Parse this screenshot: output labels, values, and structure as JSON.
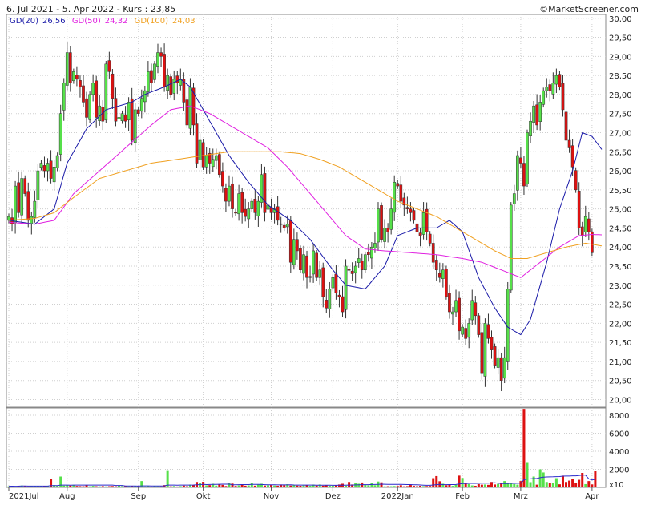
{
  "header": {
    "range_text": "6. Jul 2021 - 5. Apr 2022 - Kurs : 23,85",
    "source_text": "©MarketScreener.com"
  },
  "legend": {
    "gd20_label": "GD(20)",
    "gd20_value": "26,56",
    "gd50_label": "GD(50)",
    "gd50_value": "24,32",
    "gd100_label": "GD(100)",
    "gd100_value": "24,03"
  },
  "colors": {
    "up": "#56e04a",
    "down": "#dd1111",
    "wick": "#333333",
    "gd20": "#1a1aa8",
    "gd50": "#e020e0",
    "gd100": "#f0a020",
    "grid": "#cfcfcf",
    "vol_avg": "#2a2acc"
  },
  "chart_data": [
    {
      "type": "candlestick",
      "title": "6. Jul 2021 - 5. Apr 2022 - Kurs : 23,85",
      "last_price": 23.85,
      "ylim": [
        19.8,
        30.1
      ],
      "y_ticks": [
        "30,00",
        "29,50",
        "29,00",
        "28,50",
        "28,00",
        "27,50",
        "27,00",
        "26,50",
        "26,00",
        "25,50",
        "25,00",
        "24,50",
        "24,00",
        "23,50",
        "23,00",
        "22,50",
        "22,00",
        "21,50",
        "21,00",
        "20,50",
        "20,00"
      ],
      "y_tick_values": [
        30,
        29.5,
        29,
        28.5,
        28,
        27.5,
        27,
        26.5,
        26,
        25.5,
        25,
        24.5,
        24,
        23.5,
        23,
        22.5,
        22,
        21.5,
        21,
        20.5,
        20
      ],
      "x_ticks": [
        "2021Jul",
        "Aug",
        "Sep",
        "Okt",
        "Nov",
        "Dez",
        "2022Jan",
        "Feb",
        "Mrz",
        "Apr"
      ],
      "x_tick_index": [
        0,
        18,
        40,
        60,
        81,
        100,
        120,
        140,
        158,
        180
      ],
      "grid": true,
      "n_sessions": 184,
      "close": [
        24.8,
        24.6,
        25.6,
        24.9,
        25.8,
        25.4,
        24.7,
        24.8,
        25.2,
        26.0,
        26.2,
        26.0,
        26.2,
        25.8,
        26.1,
        26.4,
        27.5,
        28.3,
        29.1,
        28.3,
        28.6,
        28.4,
        28.2,
        27.8,
        27.4,
        28.0,
        28.3,
        27.4,
        27.7,
        27.3,
        28.8,
        28.6,
        27.9,
        27.3,
        27.4,
        27.5,
        27.3,
        27.8,
        26.8,
        27.6,
        27.5,
        27.9,
        28.1,
        28.6,
        28.3,
        28.8,
        29.1,
        29.0,
        28.2,
        28.5,
        28.0,
        28.4,
        28.3,
        28.4,
        27.8,
        27.2,
        28.2,
        27.2,
        26.2,
        26.8,
        26.1,
        26.4,
        26.2,
        26.3,
        26.4,
        25.9,
        25.6,
        25.2,
        25.6,
        25.0,
        24.9,
        25.4,
        24.9,
        24.8,
        25.0,
        25.2,
        24.9,
        25.2,
        25.9,
        24.9,
        25.1,
        24.9,
        25.0,
        24.7,
        24.6,
        24.5,
        24.6,
        23.6,
        24.2,
        23.9,
        23.4,
        23.8,
        23.2,
        23.2,
        23.9,
        23.2,
        23.4,
        22.7,
        22.4,
        22.9,
        23.2,
        22.8,
        22.7,
        22.3,
        23.5,
        23.4,
        23.3,
        23.5,
        23.7,
        23.4,
        23.8,
        23.8,
        24.0,
        24.1,
        25.0,
        24.2,
        24.5,
        24.4,
        25.0,
        25.7,
        25.6,
        25.2,
        25.1,
        25.0,
        24.9,
        24.7,
        24.4,
        24.3,
        24.9,
        24.4,
        24.1,
        23.6,
        23.4,
        23.2,
        23.4,
        22.7,
        22.3,
        22.3,
        22.6,
        21.8,
        21.9,
        21.6,
        22.0,
        22.6,
        22.2,
        21.7,
        20.7,
        22.0,
        21.6,
        21.3,
        20.9,
        21.1,
        20.5,
        21.1,
        22.9,
        25.1,
        25.4,
        26.4,
        26.2,
        25.6,
        27.0,
        27.3,
        27.7,
        27.2,
        27.8,
        28.1,
        28.2,
        28.1,
        28.3,
        28.5,
        28.2,
        27.6,
        26.8,
        26.6,
        26.1,
        25.5,
        24.5,
        24.3,
        24.8,
        24.4,
        23.85
      ],
      "volume": [
        120,
        150,
        100,
        180,
        200,
        160,
        110,
        130,
        140,
        160,
        150,
        130,
        170,
        900,
        250,
        180,
        1200,
        200,
        230,
        200,
        220,
        160,
        140,
        130,
        220,
        120,
        170,
        130,
        120,
        140,
        110,
        130,
        150,
        120,
        200,
        140,
        130,
        120,
        150,
        140,
        120,
        700,
        110,
        130,
        100,
        150,
        120,
        110,
        250,
        1900,
        120,
        150,
        100,
        140,
        200,
        130,
        300,
        260,
        600,
        500,
        620,
        220,
        250,
        400,
        200,
        340,
        280,
        150,
        500,
        420,
        160,
        220,
        300,
        190,
        220,
        500,
        190,
        300,
        400,
        200,
        230,
        300,
        200,
        180,
        320,
        240,
        350,
        200,
        260,
        200,
        180,
        210,
        260,
        180,
        310,
        200,
        320,
        190,
        220,
        190,
        180,
        260,
        320,
        400,
        190,
        600,
        320,
        520,
        400,
        540,
        260,
        230,
        500,
        240,
        650,
        560,
        120,
        130,
        130,
        150,
        160,
        240,
        120,
        140,
        260,
        170,
        130,
        180,
        140,
        150,
        160,
        1020,
        1250,
        680,
        400,
        240,
        300,
        170,
        280,
        1300,
        1040,
        450,
        360,
        220,
        180,
        360,
        300,
        320,
        280,
        600,
        320,
        380,
        400,
        700,
        420,
        500,
        360,
        300,
        700,
        8700,
        2800,
        580,
        1200,
        300,
        2000,
        1650,
        600,
        480,
        500,
        1020,
        340,
        1300,
        600,
        750,
        920,
        480,
        840,
        1600,
        360,
        700,
        330,
        1800
      ],
      "vol_ylim": [
        0,
        8800
      ],
      "vol_ticks": [
        "8000",
        "6000",
        "4000",
        "2000"
      ],
      "vol_tick_values": [
        8000,
        6000,
        4000,
        2000
      ],
      "vol_unit_label": "x10",
      "series": [
        {
          "name": "GD(20)",
          "last": 26.56,
          "anchors": [
            [
              0,
              24.7
            ],
            [
              8,
              24.6
            ],
            [
              14,
              25.0
            ],
            [
              18,
              26.2
            ],
            [
              24,
              27.1
            ],
            [
              30,
              27.6
            ],
            [
              38,
              27.8
            ],
            [
              42,
              28.0
            ],
            [
              48,
              28.2
            ],
            [
              53,
              28.4
            ],
            [
              56,
              28.2
            ],
            [
              62,
              27.3
            ],
            [
              68,
              26.4
            ],
            [
              74,
              25.7
            ],
            [
              80,
              25.1
            ],
            [
              87,
              24.7
            ],
            [
              93,
              24.2
            ],
            [
              100,
              23.4
            ],
            [
              104,
              23.0
            ],
            [
              110,
              22.9
            ],
            [
              116,
              23.5
            ],
            [
              120,
              24.3
            ],
            [
              126,
              24.5
            ],
            [
              132,
              24.5
            ],
            [
              136,
              24.7
            ],
            [
              140,
              24.4
            ],
            [
              145,
              23.2
            ],
            [
              150,
              22.4
            ],
            [
              154,
              21.9
            ],
            [
              158,
              21.7
            ],
            [
              161,
              22.1
            ],
            [
              166,
              23.6
            ],
            [
              170,
              25.0
            ],
            [
              174,
              26.0
            ],
            [
              177,
              27.0
            ],
            [
              180,
              26.9
            ],
            [
              183,
              26.56
            ]
          ]
        },
        {
          "name": "GD(50)",
          "last": 24.32,
          "anchors": [
            [
              0,
              24.65
            ],
            [
              8,
              24.6
            ],
            [
              14,
              24.7
            ],
            [
              20,
              25.4
            ],
            [
              28,
              26.0
            ],
            [
              36,
              26.6
            ],
            [
              44,
              27.2
            ],
            [
              50,
              27.6
            ],
            [
              56,
              27.7
            ],
            [
              62,
              27.5
            ],
            [
              68,
              27.2
            ],
            [
              74,
              26.9
            ],
            [
              80,
              26.6
            ],
            [
              86,
              26.1
            ],
            [
              92,
              25.5
            ],
            [
              98,
              24.9
            ],
            [
              104,
              24.3
            ],
            [
              110,
              23.95
            ],
            [
              116,
              23.9
            ],
            [
              124,
              23.85
            ],
            [
              132,
              23.8
            ],
            [
              140,
              23.7
            ],
            [
              146,
              23.6
            ],
            [
              152,
              23.4
            ],
            [
              158,
              23.2
            ],
            [
              164,
              23.6
            ],
            [
              170,
              24.0
            ],
            [
              176,
              24.3
            ],
            [
              180,
              24.33
            ],
            [
              183,
              24.32
            ]
          ]
        },
        {
          "name": "GD(100)",
          "last": 24.03,
          "anchors": [
            [
              0,
              24.7
            ],
            [
              8,
              24.75
            ],
            [
              14,
              24.9
            ],
            [
              20,
              25.3
            ],
            [
              28,
              25.8
            ],
            [
              36,
              26.0
            ],
            [
              44,
              26.2
            ],
            [
              52,
              26.3
            ],
            [
              60,
              26.4
            ],
            [
              68,
              26.5
            ],
            [
              76,
              26.5
            ],
            [
              84,
              26.5
            ],
            [
              90,
              26.45
            ],
            [
              96,
              26.3
            ],
            [
              102,
              26.1
            ],
            [
              108,
              25.8
            ],
            [
              114,
              25.5
            ],
            [
              120,
              25.2
            ],
            [
              126,
              25.0
            ],
            [
              132,
              24.8
            ],
            [
              138,
              24.5
            ],
            [
              144,
              24.2
            ],
            [
              150,
              23.9
            ],
            [
              155,
              23.7
            ],
            [
              160,
              23.7
            ],
            [
              166,
              23.85
            ],
            [
              172,
              24.0
            ],
            [
              178,
              24.1
            ],
            [
              183,
              24.03
            ]
          ]
        }
      ]
    }
  ]
}
